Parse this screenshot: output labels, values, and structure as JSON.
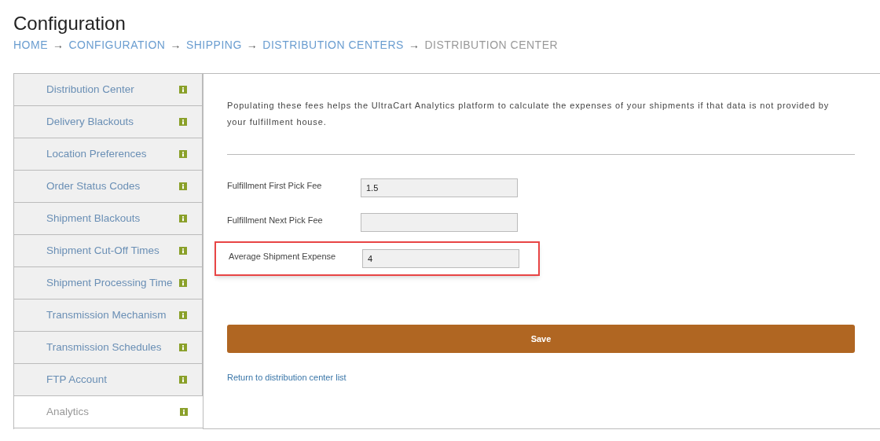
{
  "page_title": "Configuration",
  "breadcrumb": [
    {
      "label": "HOME",
      "separator": "→",
      "current": false
    },
    {
      "label": "CONFIGURATION",
      "separator": "→",
      "current": false
    },
    {
      "label": "SHIPPING",
      "separator": "→",
      "current": false
    },
    {
      "label": "DISTRIBUTION CENTERS",
      "separator": "→",
      "current": false
    },
    {
      "label": "DISTRIBUTION CENTER",
      "current": true
    }
  ],
  "sidebar": {
    "items": [
      {
        "label": "Distribution Center",
        "selected": false
      },
      {
        "label": "Delivery Blackouts",
        "selected": false
      },
      {
        "label": "Location Preferences",
        "selected": false
      },
      {
        "label": "Order Status Codes",
        "selected": false
      },
      {
        "label": "Shipment Blackouts",
        "selected": false
      },
      {
        "label": "Shipment Cut-Off Times",
        "selected": false
      },
      {
        "label": "Shipment Processing Time",
        "selected": false
      },
      {
        "label": "Transmission Mechanism",
        "selected": false
      },
      {
        "label": "Transmission Schedules",
        "selected": false
      },
      {
        "label": "FTP Account",
        "selected": false
      },
      {
        "label": "Analytics",
        "selected": true
      }
    ]
  },
  "intro": "Populating these fees helps the UltraCart Analytics platform to calculate the expenses of your shipments if that data is not provided by your fulfillment house.",
  "fields": [
    {
      "label": "Fulfillment First Pick Fee",
      "value": "1.5",
      "highlighted": false
    },
    {
      "label": "Fulfillment Next Pick Fee",
      "highlighted": false
    },
    {
      "label": "Average Shipment Expense",
      "value": "4",
      "highlighted": true
    }
  ],
  "save_button": "Save",
  "return_link": "Return to distribution center list"
}
